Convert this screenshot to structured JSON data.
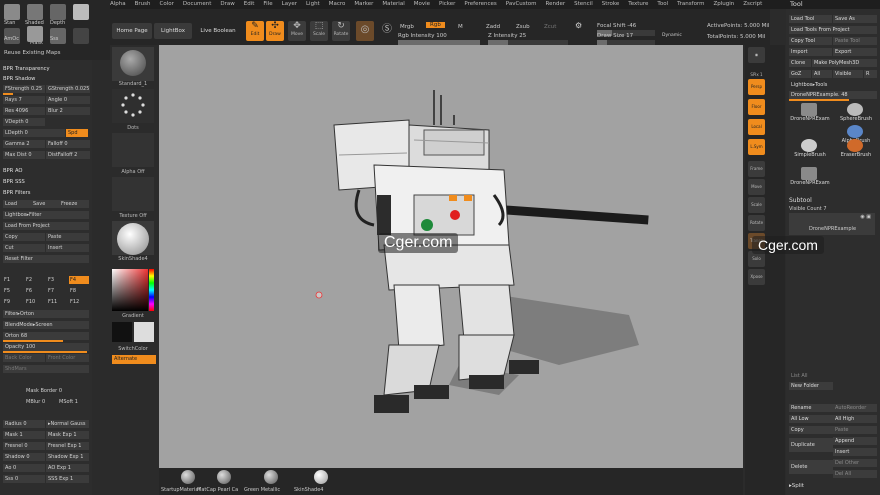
{
  "menu": [
    "Alpha",
    "Brush",
    "Color",
    "Document",
    "Draw",
    "Edit",
    "File",
    "Layer",
    "Light",
    "Macro",
    "Marker",
    "Material",
    "Movie",
    "Picker",
    "Preferences",
    "PavCustom",
    "Render",
    "Stencil",
    "Stroke",
    "Texture",
    "Tool",
    "Transform",
    "Zplugin",
    "Zscript"
  ],
  "brush_strip": {
    "items": [
      "Stan",
      "Shaded",
      "Depth",
      "Mask",
      "AmOc",
      "Mask",
      "Sss",
      "Flat"
    ],
    "reuse": "Reuse Existing Maps"
  },
  "toolbar": {
    "home": "Home Page",
    "lightbox": "LightBox",
    "live_boolean": "Live Boolean",
    "edit": "Edit",
    "draw": "Draw",
    "move": "Move",
    "scale": "Scale",
    "rotate": "Rotate",
    "mrgb": "Mrgb",
    "rgb": "Rgb",
    "m": "M",
    "zadd": "Zadd",
    "zsub": "Zsub",
    "zcut": "Zcut",
    "rgb_intensity": "Rgb Intensity 100",
    "z_intensity": "Z Intensity 25",
    "focal_shift": "Focal Shift -46",
    "draw_size": "Draw Size 17",
    "dynamic": "Dynamic",
    "active_points": "ActivePoints: 5.000 Mil",
    "total_points": "TotalPoints: 5.000 Mil"
  },
  "left_panel": {
    "bpr_transparency": "BPR Transparency",
    "bpr_shadow": "BPR Shadow",
    "fstrength": "FStrength 0.25",
    "gstrength": "GStrength 0.025",
    "rays": "Rays 7",
    "angle": "Angle 0",
    "res": "Res 4096",
    "blur": "Blur 2",
    "vdepth": "VDepth 0",
    "ldepth": "LDepth 0",
    "spd": "Spd",
    "gamma": "Gamma 2",
    "falloff": "Falloff 0",
    "max_dist": "Max Dist 0",
    "dist_falloff": "DistFalloff 2",
    "bpr_ao": "BPR AO",
    "bpr_sss": "BPR SSS",
    "bpr_filters": "BPR Filters",
    "load": "Load",
    "save": "Save",
    "freeze": "Freeze",
    "lightbox_filter": "Lightbox▸Filter",
    "load_from_project": "Load From Project",
    "copy": "Copy",
    "paste": "Paste",
    "cut": "Cut",
    "insert": "Insert",
    "reset_filter": "Reset Filter",
    "filters": [
      "F1",
      "F2",
      "F3",
      "F4",
      "F5",
      "F6",
      "F7",
      "F8",
      "F9",
      "F10",
      "F11",
      "F12"
    ],
    "filter_orton": "Filter▸Orton",
    "blend_mode": "BlendMode▸Screen",
    "orton": "Orton 68",
    "opacity": "Opacity 100",
    "back_color": "Back Color",
    "front_color": "Front Color",
    "shadow_flat": "ShdMars",
    "mask_border": "Mask Border 0",
    "mblur": "MBlur 0",
    "msoft": "MSoft 1",
    "radius": "Radius 0",
    "normal_gauss": "▸Normal Gauss",
    "mask": "Mask 1",
    "mask_exp": "Mask Exp 1",
    "fresnel": "Fresnel 0",
    "fresnel_exp": "Fresnel Exp 1",
    "shadow": "Shadow 0",
    "shadow_exp": "Shadow Exp 1",
    "ao": "Ao 0",
    "ao_exp": "AO Exp 1",
    "sss": "Sss 0",
    "sss_exp": "SSS Exp 1"
  },
  "material_column": {
    "standard": "Standard_1",
    "dots": "Dots",
    "alpha": "Alpha Off",
    "texture": "Texture Off",
    "skinshade": "SkinShade4",
    "gradient": "Gradient",
    "switch_color": "SwitchColor",
    "alternate": "Alternate"
  },
  "right_icons": [
    "SPix 1",
    "Persp",
    "Floor",
    "Local",
    "L.Sym",
    "Frame",
    "Move",
    "Scale",
    "Rotate",
    "Transp",
    "Solo",
    "Xpose"
  ],
  "tool_panel": {
    "title": "Tool",
    "load_tool": "Load Tool",
    "save_as": "Save As",
    "load_tools_from_project": "Load Tools From Project",
    "copy_tool": "Copy Tool",
    "paste_tool": "Paste Tool",
    "import": "Import",
    "export": "Export",
    "clone": "Clone",
    "make_polymesh": "Make PolyMesh3D",
    "goz": "GoZ",
    "all": "All",
    "visible": "Visible",
    "r": "R",
    "lightbox_tools": "Lightbox▸Tools",
    "drone_value": "DroneNPRExample. 48",
    "tools": [
      "DroneNPRExam",
      "SphereBrush",
      "AlphaBrush",
      "SimpleBrush",
      "EraserBrush",
      "DroneNPRExam"
    ],
    "subtool": "Subtool",
    "visible_count": "Visible Count 7",
    "subtool_item": "DroneNPRExample",
    "list_all": "List All",
    "new_folder": "New Folder",
    "rename": "Rename",
    "autoreorder": "AutoReorder",
    "all_low": "All Low",
    "all_high": "All High",
    "copy": "Copy",
    "paste": "Paste",
    "duplicate": "Duplicate",
    "append": "Append",
    "insert": "Insert",
    "delete": "Delete",
    "del_other": "Del Other",
    "del_all": "Del All",
    "split": "▸Split"
  },
  "bottom_shelf": [
    "StartupMaterial",
    "MatCap Pearl Ca",
    "Green Metallic",
    "SkinShade4"
  ],
  "watermark": "Cger.com",
  "colors": {
    "accent": "#f08c1d",
    "canvas": "#a2a2a2"
  }
}
